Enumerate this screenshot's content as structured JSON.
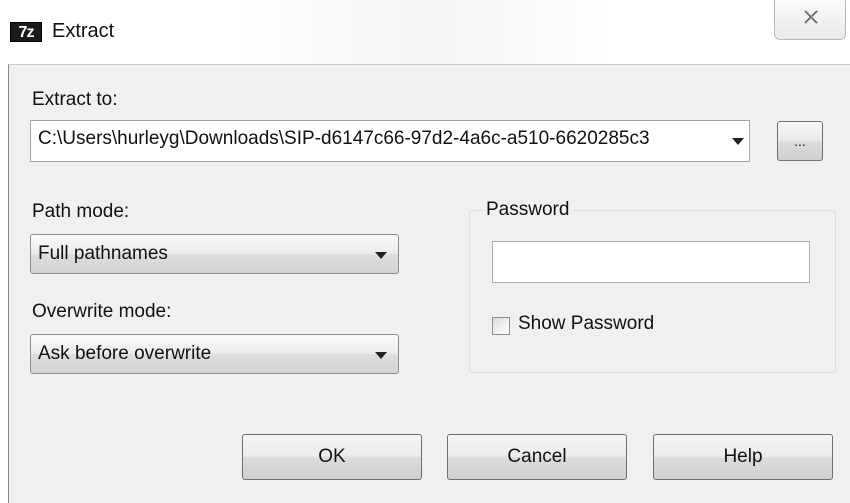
{
  "window": {
    "app_icon_text": "7z",
    "title": "Extract",
    "close_glyph": "✕"
  },
  "extract_to": {
    "label": "Extract to:",
    "value": "C:\\Users\\hurleyg\\Downloads\\SIP-d6147c66-97d2-4a6c-a510-6620285c3",
    "browse_label": "..."
  },
  "path_mode": {
    "label": "Path mode:",
    "selected": "Full pathnames"
  },
  "overwrite_mode": {
    "label": "Overwrite mode:",
    "selected": "Ask before overwrite"
  },
  "password": {
    "group_label": "Password",
    "value": "",
    "show_password_label": "Show Password",
    "show_password_checked": false
  },
  "buttons": {
    "ok": "OK",
    "cancel": "Cancel",
    "help": "Help"
  }
}
